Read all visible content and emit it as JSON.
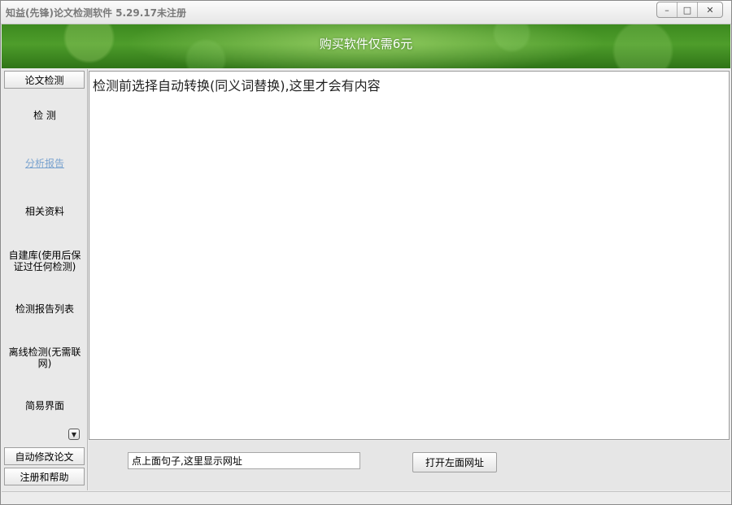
{
  "window": {
    "title": "知益(先锋)论文检测软件 5.29.17未注册",
    "minimize_glyph": "–",
    "maximize_glyph": "□",
    "close_glyph": "✕"
  },
  "banner": {
    "text": "购买软件仅需6元"
  },
  "sidebar": {
    "top_button": "论文检测",
    "items": [
      {
        "label": "检 测"
      },
      {
        "label": "分析报告"
      },
      {
        "label": "相关资料"
      },
      {
        "label": "自建库(使用后保证过任何检测)"
      },
      {
        "label": "检测报告列表"
      },
      {
        "label": "离线检测(无需联网)"
      },
      {
        "label": "简易界面"
      }
    ],
    "scroll_glyph": "▼",
    "bottom_buttons": [
      {
        "label": "自动修改论文"
      },
      {
        "label": "注册和帮助"
      }
    ]
  },
  "main": {
    "content_text": "检测前选择自动转换(同义词替换),这里才会有内容"
  },
  "bottom": {
    "url_value": "点上面句子,这里显示网址",
    "open_button": "打开左面网址"
  },
  "icons": {
    "scroll": "chevron-down-icon"
  }
}
